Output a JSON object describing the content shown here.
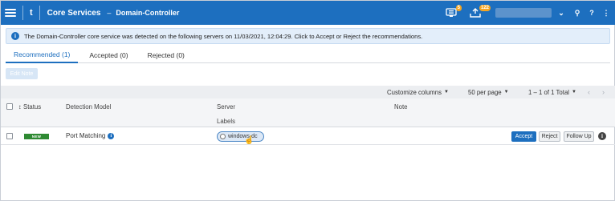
{
  "topbar": {
    "app_icon": "t",
    "title": "Core Services",
    "separator": "–",
    "page": "Domain-Controller",
    "notifications_badge": "5",
    "downloads_badge": "122",
    "icons": [
      "menu-icon",
      "alert-icon",
      "upload-icon",
      "chevron-down-icon",
      "search-icon",
      "help-icon",
      "more-icon"
    ],
    "chevron": "⌄",
    "search": "⚲",
    "help": "?",
    "more": "⋮"
  },
  "banner": {
    "icon": "i",
    "text": "The Domain-Controller core service was detected on the following servers on 11/03/2021, 12:04:29. Click to Accept or Reject the recommendations."
  },
  "tabs": [
    {
      "label": "Recommended (1)",
      "active": true
    },
    {
      "label": "Accepted (0)",
      "active": false
    },
    {
      "label": "Rejected (0)",
      "active": false
    }
  ],
  "actions": {
    "edit_note": "Edit Note"
  },
  "toolbar": {
    "customize_columns": "Customize columns",
    "per_page": "50 per page",
    "pagination": "1 – 1 of 1 Total",
    "prev": "‹",
    "next": "›"
  },
  "table": {
    "headers": {
      "status": "Status",
      "sort_marker": "↕",
      "detection_model": "Detection Model",
      "server": "Server",
      "labels": "Labels",
      "note": "Note"
    },
    "rows": [
      {
        "status_badge": "NEW",
        "detection_model": "Port Matching",
        "model_info": "i",
        "label": "windows-dc",
        "accept": "Accept",
        "reject": "Reject",
        "follow_up": "Follow Up",
        "info": "i"
      }
    ]
  },
  "colors": {
    "brand": "#1d6fbf",
    "new_badge": "#2f8a33",
    "badge_orange": "#f5a623"
  }
}
